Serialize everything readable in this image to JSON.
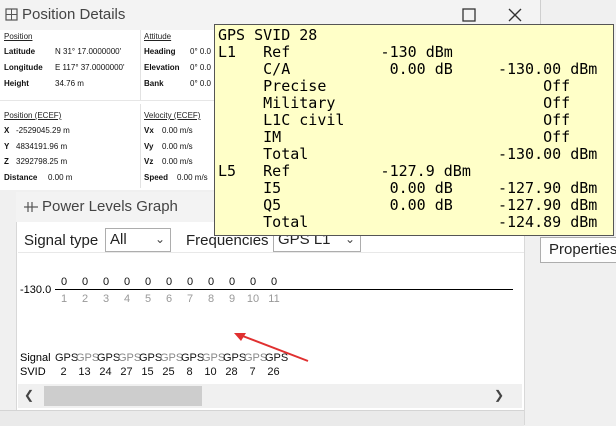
{
  "position_window": {
    "title": "Position Details",
    "sections": {
      "position": {
        "header": "Position",
        "rows": [
          {
            "label": "Latitude",
            "value": "N 31° 17.0000000'"
          },
          {
            "label": "Longitude",
            "value": "E 117° 37.0000000'"
          },
          {
            "label": "Height",
            "value": "34.76 m"
          }
        ]
      },
      "attitude": {
        "header": "Attitude",
        "rows": [
          {
            "label": "Heading",
            "value": "0° 0.0"
          },
          {
            "label": "Elevation",
            "value": "0° 0.0"
          },
          {
            "label": "Bank",
            "value": "0° 0.0"
          }
        ]
      },
      "ecef_position": {
        "header": "Position (ECEF)",
        "rows": [
          {
            "label": "X",
            "value": "-2529045.29 m"
          },
          {
            "label": "Y",
            "value": "4834191.96 m"
          },
          {
            "label": "Z",
            "value": "3292798.25 m"
          },
          {
            "label": "Distance",
            "value": "0.00 m"
          }
        ]
      },
      "ecef_velocity": {
        "header": "Velocity (ECEF)",
        "rows": [
          {
            "label": "Vx",
            "value": "0.00 m/s"
          },
          {
            "label": "Vy",
            "value": "0.00 m/s"
          },
          {
            "label": "Vz",
            "value": "0.00 m/s"
          },
          {
            "label": "Speed",
            "value": "0.00 m/s"
          }
        ]
      }
    }
  },
  "tooltip": {
    "lines": [
      "GPS SVID 28",
      "L1   Ref          -130 dBm",
      "     C/A           0.00 dB     -130.00 dBm",
      "     Precise                        Off",
      "     Military                       Off",
      "     L1C civil                      Off",
      "     IM                             Off",
      "     Total                     -130.00 dBm",
      "L5   Ref          -127.9 dBm",
      "     I5            0.00 dB     -127.90 dBm",
      "     Q5            0.00 dB     -127.90 dBm",
      "     Total                     -124.89 dBm"
    ]
  },
  "power_graph": {
    "title": "Power Levels Graph",
    "signal_type_label": "Signal type",
    "signal_type_value": "All",
    "frequencies_label": "Frequencies",
    "frequencies_value": "GPS L1",
    "y_label": "-130.0",
    "power_values": [
      "0",
      "0",
      "0",
      "0",
      "0",
      "0",
      "0",
      "0",
      "0",
      "0",
      "0"
    ],
    "indices": [
      "1",
      "2",
      "3",
      "4",
      "5",
      "6",
      "7",
      "8",
      "9",
      "10",
      "11"
    ],
    "signal_row_label": "Signal",
    "svid_row_label": "SVID",
    "signals": [
      "GPS",
      "GPS",
      "GPS",
      "GPS",
      "GPS",
      "GPS",
      "GPS",
      "GPS",
      "GPS",
      "GPS",
      "GPS"
    ],
    "svids": [
      "2",
      "13",
      "24",
      "27",
      "15",
      "25",
      "8",
      "10",
      "28",
      "7",
      "26"
    ]
  },
  "right_panel": {
    "properties_label": "Properties"
  },
  "colors": {
    "tooltip_bg": "#ffffc8",
    "annotation_arrow": "#e03030"
  }
}
